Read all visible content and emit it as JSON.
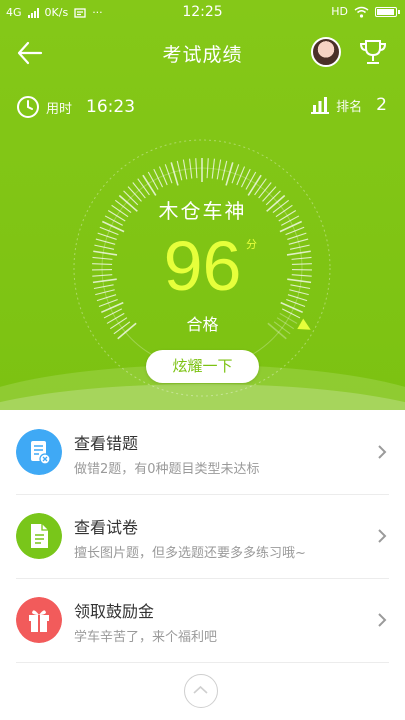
{
  "status_bar": {
    "network": "4G",
    "speed": "0K/s",
    "extra": "···",
    "time": "12:25",
    "hd": "HD"
  },
  "nav": {
    "title": "考试成绩"
  },
  "stats": {
    "time_label": "用时",
    "time_value": "16:23",
    "rank_label": "排名",
    "rank_value": "2"
  },
  "gauge": {
    "name": "木仓车神",
    "score": "96",
    "unit": "分",
    "result": "合格",
    "score_fraction": 0.96
  },
  "share_label": "炫耀一下",
  "list": [
    {
      "title": "查看错题",
      "subtitle": "做错2题，有0种题目类型未达标",
      "color": "#3fa9f5",
      "icon": "wrong-questions-icon"
    },
    {
      "title": "查看试卷",
      "subtitle": "擅长图片题，但多选题还要多多练习哦~",
      "color": "#79c61a",
      "icon": "exam-paper-icon"
    },
    {
      "title": "领取鼓励金",
      "subtitle": "学车辛苦了，来个福利吧",
      "color": "#f25b5b",
      "icon": "gift-icon"
    }
  ],
  "colors": {
    "header": "#7cc212",
    "score": "#e6ff3b"
  }
}
